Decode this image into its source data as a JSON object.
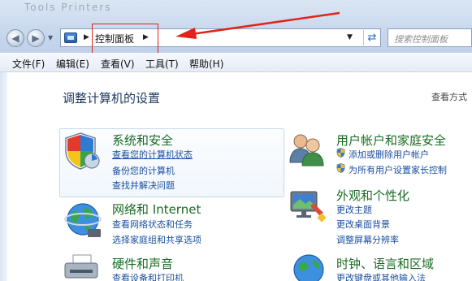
{
  "window": {
    "title_faded": "Tools   Printers"
  },
  "address_bar": {
    "path": "控制面板"
  },
  "search": {
    "placeholder": "搜索控制面板"
  },
  "menu": {
    "items": [
      "文件(F)",
      "编辑(E)",
      "查看(V)",
      "工具(T)",
      "帮助(H)"
    ]
  },
  "main": {
    "heading": "调整计算机的设置",
    "view_by": "查看方式"
  },
  "categories": {
    "system_security": {
      "title": "系统和安全",
      "links": [
        "查看您的计算机状态",
        "备份您的计算机",
        "查找并解决问题"
      ]
    },
    "user_accounts": {
      "title": "用户帐户和家庭安全",
      "links": [
        "添加或删除用户帐户",
        "为所有用户设置家长控制"
      ]
    },
    "network": {
      "title": "网络和 Internet",
      "links": [
        "查看网络状态和任务",
        "选择家庭组和共享选项"
      ]
    },
    "appearance": {
      "title": "外观和个性化",
      "links": [
        "更改主题",
        "更改桌面背景",
        "调整屏幕分辨率"
      ]
    },
    "hardware": {
      "title": "硬件和声音",
      "links": [
        "查看设备和打印机"
      ]
    },
    "clock": {
      "title": "时钟、语言和区域",
      "links": [
        "更改键盘或其他输入法"
      ]
    }
  },
  "colors": {
    "category_title": "#1a6b23",
    "link": "#1b4fa0",
    "annotation": "#e2231a"
  }
}
